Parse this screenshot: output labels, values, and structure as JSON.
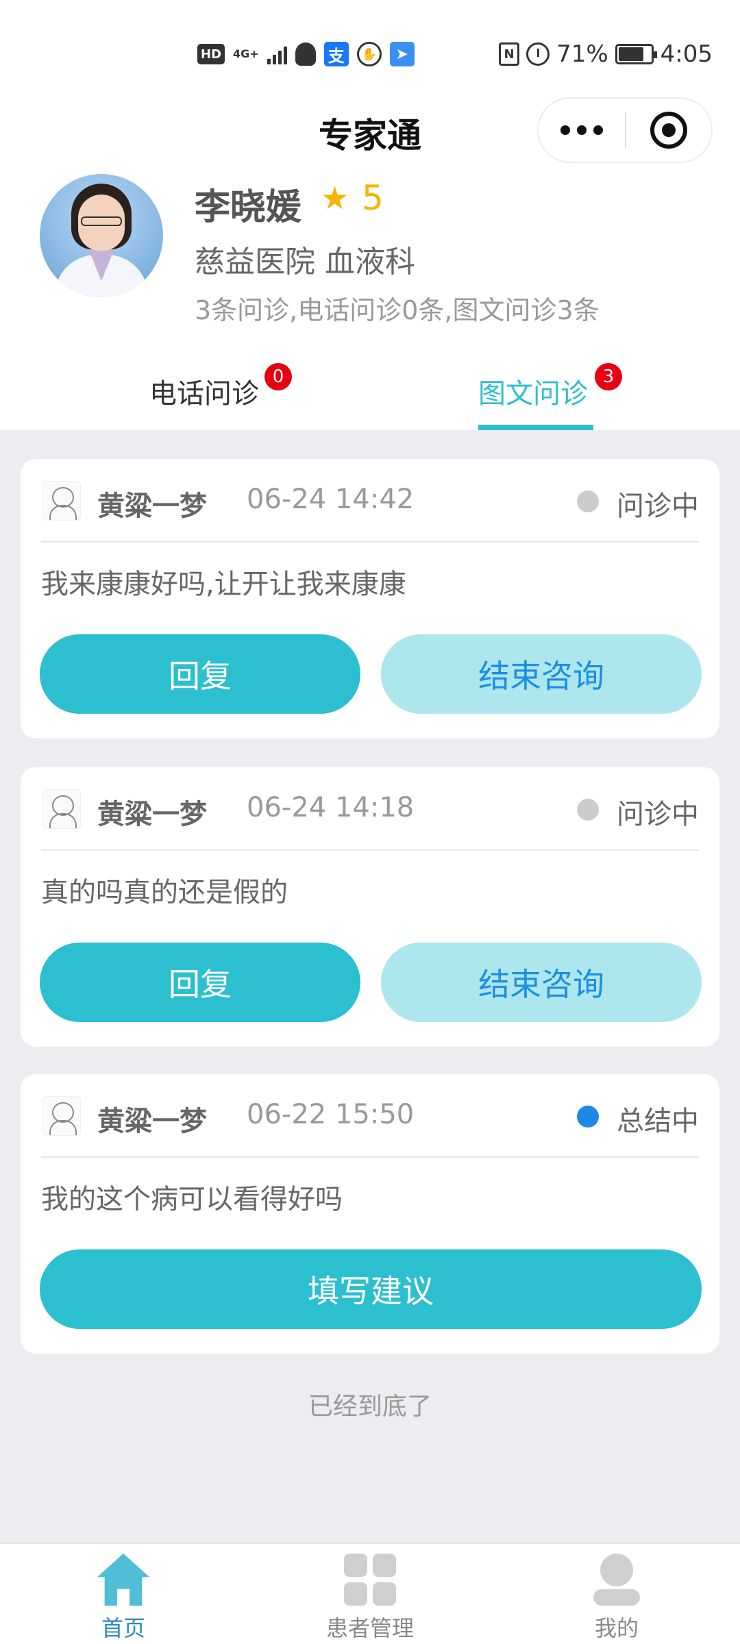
{
  "status_bar": {
    "hd": "HD",
    "network": "4G+",
    "battery_percent": "71%",
    "time": "4:05"
  },
  "header": {
    "title": "专家通"
  },
  "doctor": {
    "name": "李晓媛",
    "rating": "5",
    "hospital": "慈益医院 血液科",
    "stats": "3条问诊,电话问诊0条,图文问诊3条"
  },
  "tabs": [
    {
      "label": "电话问诊",
      "badge": "0",
      "active": false
    },
    {
      "label": "图文问诊",
      "badge": "3",
      "active": true
    }
  ],
  "consultations": [
    {
      "patient": "黄粱一梦",
      "time": "06-24 14:42",
      "status": "问诊中",
      "status_color": "#cccccc",
      "message": "我来康康好吗,让开让我来康康",
      "buttons": [
        "回复",
        "结束咨询"
      ]
    },
    {
      "patient": "黄粱一梦",
      "time": "06-24 14:18",
      "status": "问诊中",
      "status_color": "#cccccc",
      "message": "真的吗真的还是假的",
      "buttons": [
        "回复",
        "结束咨询"
      ]
    },
    {
      "patient": "黄粱一梦",
      "time": "06-22 15:50",
      "status": "总结中",
      "status_color": "#1e88e5",
      "message": "我的这个病可以看得好吗",
      "buttons": [
        "填写建议"
      ]
    }
  ],
  "list_end": "已经到底了",
  "bottom_nav": [
    {
      "label": "首页",
      "icon": "home-icon",
      "active": true
    },
    {
      "label": "患者管理",
      "icon": "grid-icon",
      "active": false
    },
    {
      "label": "我的",
      "icon": "user-icon",
      "active": false
    }
  ],
  "colors": {
    "accent": "#2cbfcf",
    "accent_light": "#ade6ec",
    "link_blue": "#1a8fe6",
    "badge_red": "#e60012",
    "star": "#f5b400",
    "nav_active": "#2d86c9"
  }
}
